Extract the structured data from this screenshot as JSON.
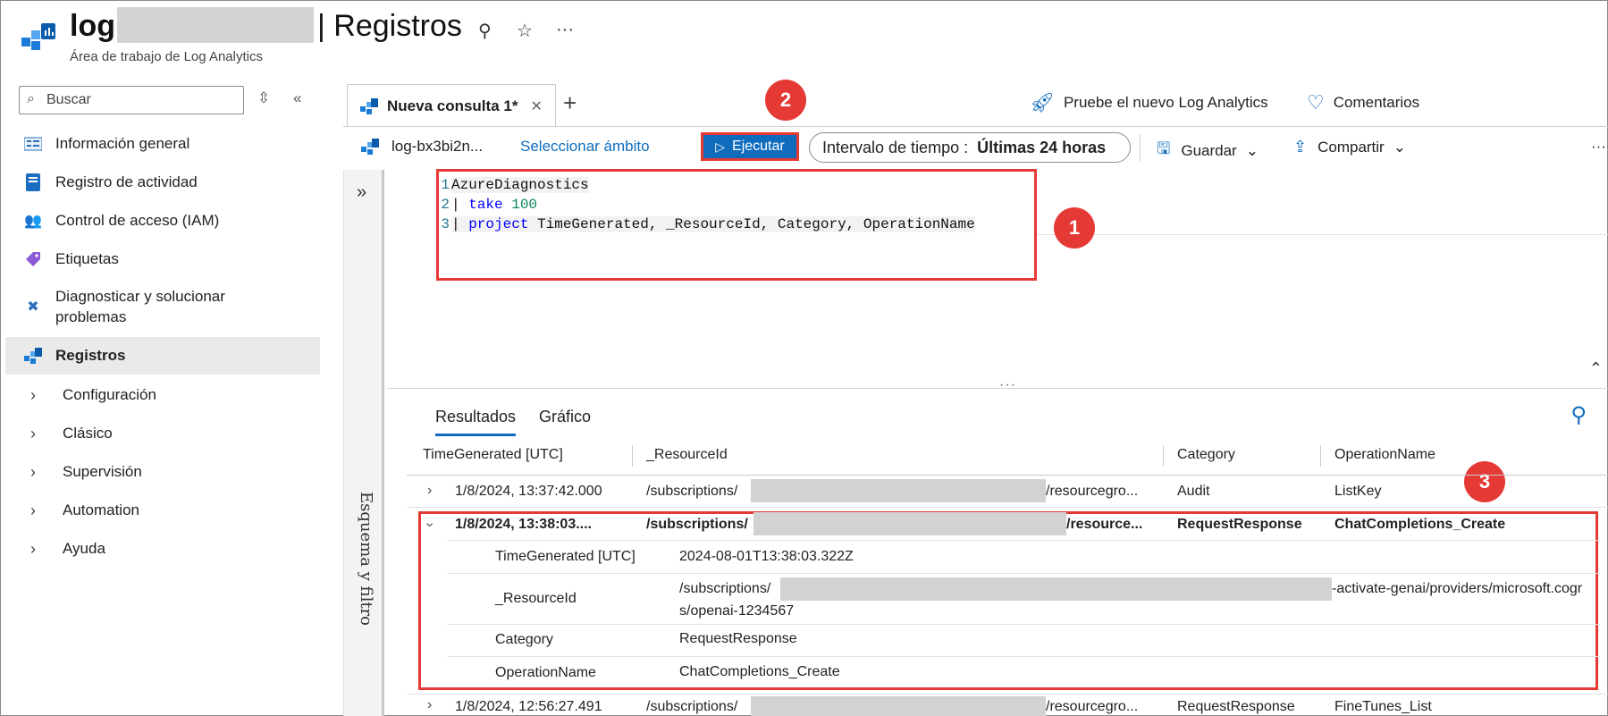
{
  "header": {
    "title_prefix": "log",
    "title_suffix": "| Registros",
    "subtitle": "Área de trabajo de Log Analytics"
  },
  "sidebar": {
    "search_placeholder": "Buscar",
    "items": [
      {
        "label": "Información general",
        "icon": "overview-icon"
      },
      {
        "label": "Registro de actividad",
        "icon": "activity-log-icon"
      },
      {
        "label": "Control de acceso (IAM)",
        "icon": "iam-icon"
      },
      {
        "label": "Etiquetas",
        "icon": "tag-icon"
      },
      {
        "label": "Diagnosticar y solucionar problemas",
        "icon": "wrench-icon"
      },
      {
        "label": "Registros",
        "icon": "logs-icon",
        "active": true
      },
      {
        "label": "Configuración",
        "expandable": true
      },
      {
        "label": "Clásico",
        "expandable": true
      },
      {
        "label": "Supervisión",
        "expandable": true
      },
      {
        "label": "Automation",
        "expandable": true
      },
      {
        "label": "Ayuda",
        "expandable": true
      }
    ]
  },
  "tabs": {
    "active_label": "Nueva consulta 1*",
    "new_log_analytics": "Pruebe el nuevo Log Analytics",
    "feedback": "Comentarios"
  },
  "toolbar": {
    "scope": "log-bx3bi2n...",
    "select_scope": "Seleccionar ámbito",
    "run": "Ejecutar",
    "time_label": "Intervalo de tiempo :",
    "time_value": "Últimas 24 horas",
    "save": "Guardar",
    "share": "Compartir"
  },
  "editor": {
    "line_numbers": [
      "1",
      "2",
      "3"
    ],
    "line1": "AzureDiagnostics",
    "line2_pipe": "| ",
    "line2_kw": "take",
    "line2_num": "100",
    "line3_pipe": "| ",
    "line3_kw": "project",
    "line3_rest": " TimeGenerated, _ResourceId, Category, OperationName"
  },
  "side_panel_label": "Esquema y filtro",
  "results": {
    "tabs": [
      "Resultados",
      "Gráfico"
    ],
    "columns": [
      "TimeGenerated [UTC]",
      "_ResourceId",
      "Category",
      "OperationName"
    ],
    "rows": [
      {
        "time": "1/8/2024, 13:37:42.000",
        "res_prefix": "/subscriptions/",
        "res_suffix": "/resourcegro...",
        "category": "Audit",
        "operation": "ListKey"
      },
      {
        "time": "1/8/2024, 13:38:03....",
        "res_prefix": "/subscriptions/",
        "res_suffix": "/resource...",
        "category": "RequestResponse",
        "operation": "ChatCompletions_Create",
        "expanded": true
      },
      {
        "time": "1/8/2024, 12:56:27.491",
        "res_prefix": "/subscriptions/",
        "res_suffix": "/resourcegro...",
        "category": "RequestResponse",
        "operation": "FineTunes_List"
      }
    ],
    "detail": {
      "time_label": "TimeGenerated [UTC]",
      "time_value": "2024-08-01T13:38:03.322Z",
      "resource_label": "_ResourceId",
      "resource_prefix": "/subscriptions/",
      "resource_suffix": "-activate-genai/providers/microsoft.cogr",
      "resource_line2": "s/openai-1234567",
      "category_label": "Category",
      "category_value": "RequestResponse",
      "operation_label": "OperationName",
      "operation_value": "ChatCompletions_Create"
    }
  },
  "callouts": [
    "1",
    "2",
    "3"
  ],
  "colors": {
    "accent": "#0f6cbd",
    "callout": "#e53935"
  }
}
